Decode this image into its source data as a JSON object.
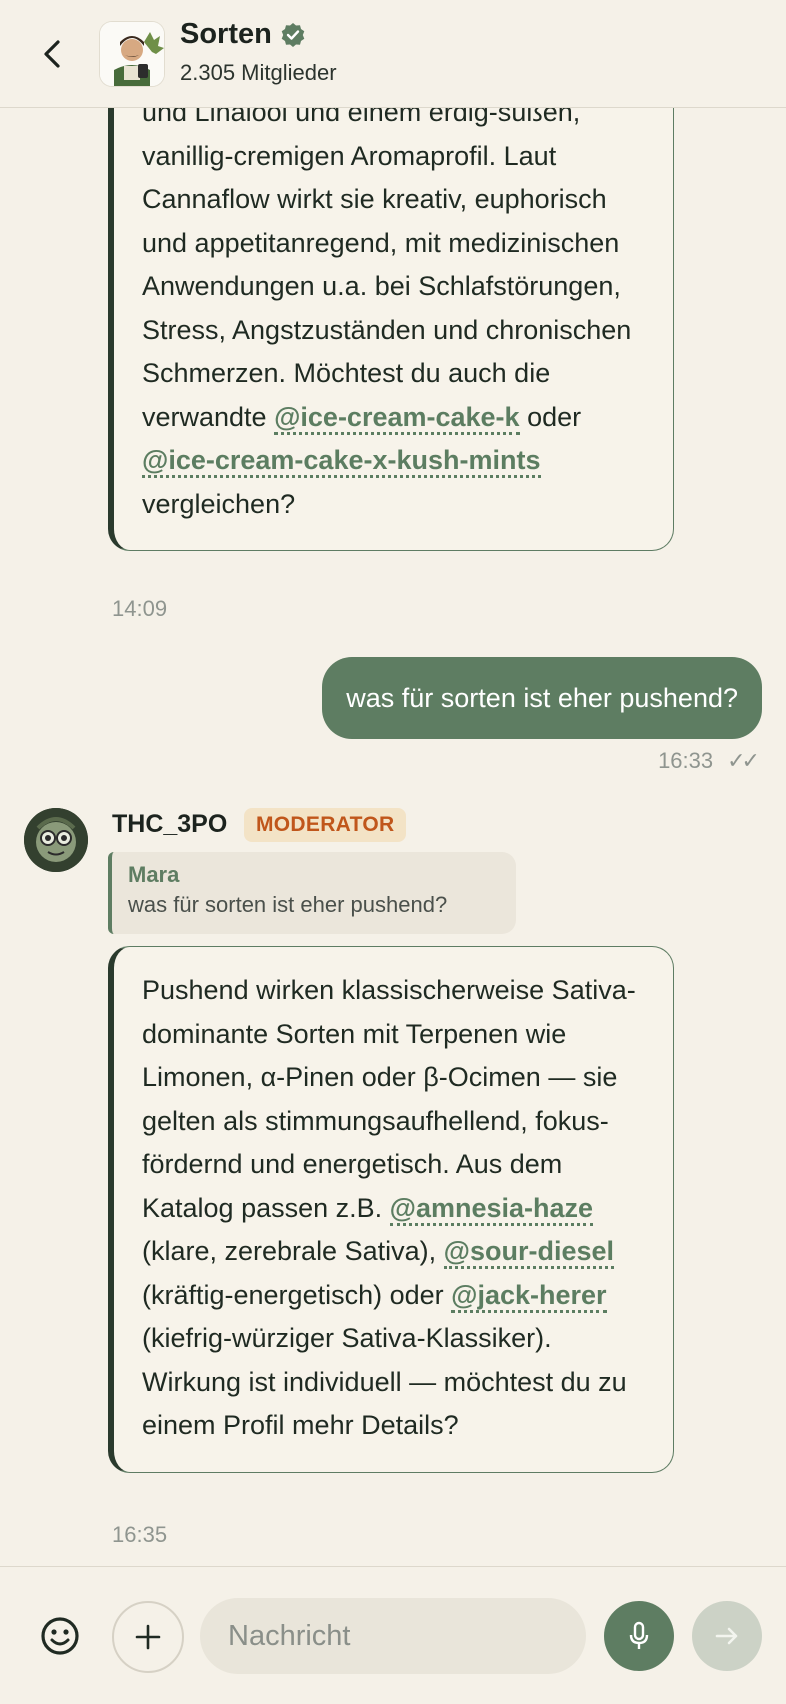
{
  "header": {
    "title": "Sorten",
    "members": "2.305 Mitglieder"
  },
  "messages": {
    "bot1": {
      "lines_before": "und Linalool und einem erdig-süßen, vanillig-cremigen Aromaprofil. Laut Cannaflow wirkt sie kreativ, euphorisch und appetitanregend, mit medizinischen Anwendungen u.a. bei Schlafstörungen, Stress, Angstzuständen und chronischen Schmerzen. Möchtest du auch die verwandte ",
      "mention1": "@ice-cream-cake-k",
      "mid": " oder ",
      "mention2": "@ice-cream-cake-x-kush-mints",
      "end": " vergleichen?",
      "time": "14:09"
    },
    "user1": {
      "text": "was für sorten ist eher pushend?",
      "time": "16:33",
      "status": "✓✓"
    },
    "bot2": {
      "sender": "THC_3PO",
      "badge": "MODERATOR",
      "quote_author": "Mara",
      "quote_text": "was für sorten ist eher pushend?",
      "p1": "Pushend wirken klassischerweise Sativa-dominante Sorten mit Terpenen wie Limonen, α-Pinen oder β-Ocimen — sie gelten als stimmungsaufhellend, fokus-fördernd und energetisch. Aus dem Katalog passen z.B. ",
      "mention1": "@amnesia-haze",
      "p2": " (klare, zerebrale Sativa), ",
      "mention2": "@sour-diesel",
      "p3": " (kräftig-energetisch) oder ",
      "mention3": "@jack-herer",
      "p4": " (kiefrig-würziger Sativa-Klassiker). Wirkung ist individuell — möchtest du zu einem Profil mehr Details?",
      "time": "16:35"
    }
  },
  "composer": {
    "placeholder": "Nachricht"
  },
  "colors": {
    "accent": "#5e7d62",
    "background": "#f5f1e8",
    "moderator": "#c0561b"
  },
  "icons": {
    "back": "chevron-left-icon",
    "verified": "verified-badge-icon",
    "emoji": "smiley-icon",
    "plus": "plus-icon",
    "mic": "microphone-icon",
    "send": "arrow-right-icon"
  }
}
